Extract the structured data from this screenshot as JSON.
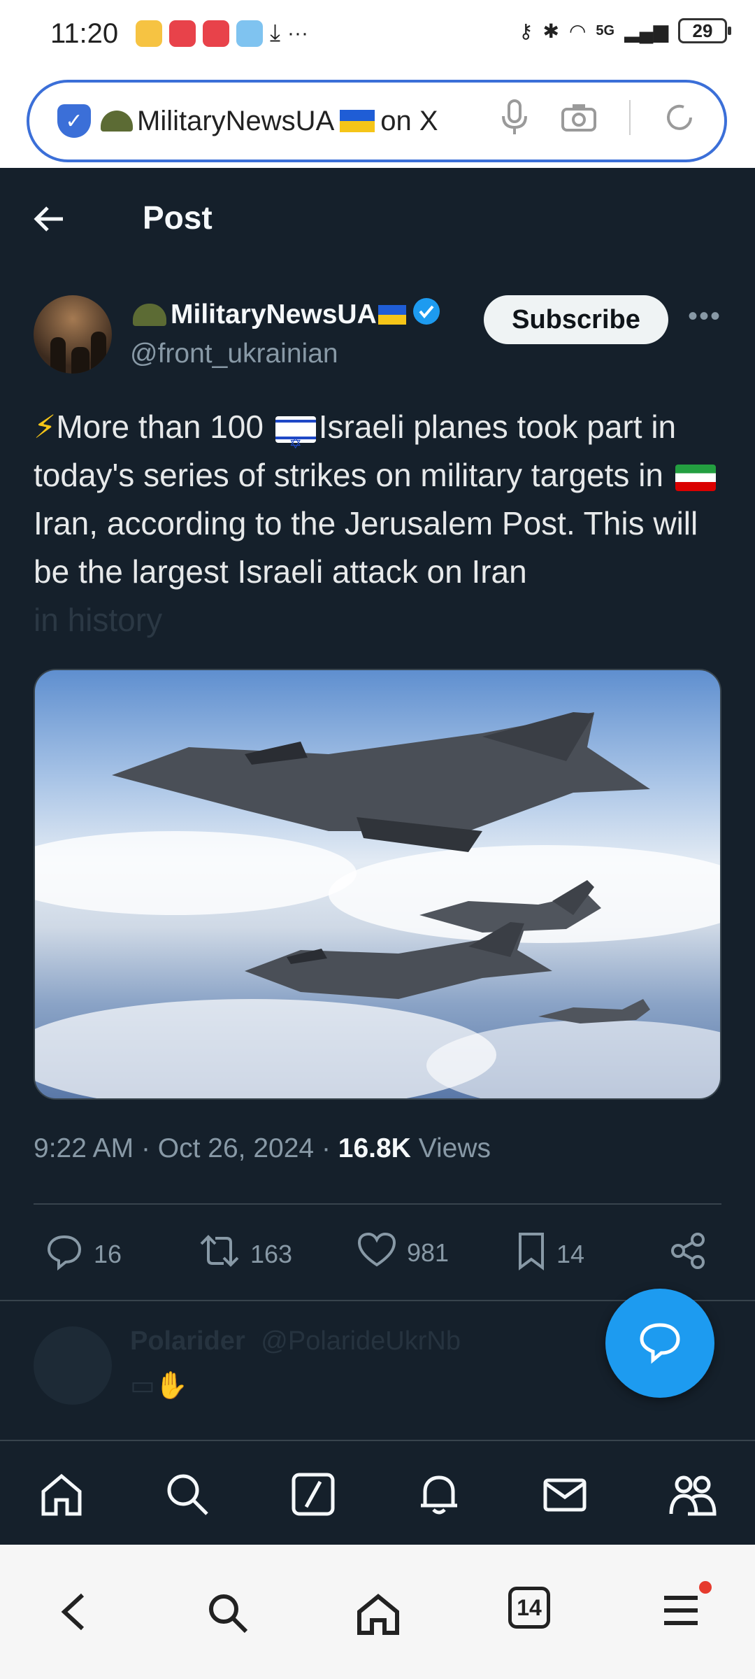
{
  "status_bar": {
    "time": "11:20",
    "battery": "29",
    "network": "5G"
  },
  "browser": {
    "url_title_prefix": "MilitaryNewsUA",
    "url_title_suffix": "on X",
    "tabs_count": "14"
  },
  "header": {
    "title": "Post"
  },
  "author": {
    "name": "MilitaryNewsUA",
    "handle": "@front_ukrainian",
    "subscribe_label": "Subscribe",
    "more_label": "•••"
  },
  "tweet": {
    "text_part1": "More than 100 ",
    "text_part2": "Israeli planes took part in today's series of strikes on military targets in ",
    "text_part3": "Iran, according to the Jerusalem Post. This will be the largest Israeli attack on Iran",
    "text_faded": "in history"
  },
  "meta": {
    "time": "9:22 AM",
    "date": "Oct 26, 2024",
    "views_count": "16.8K",
    "views_label": "Views"
  },
  "actions": {
    "replies": "16",
    "reposts": "163",
    "likes": "981",
    "bookmarks": "14"
  },
  "reply_preview": {
    "name": "Polarider",
    "handle": "@PolarideUkrNb"
  },
  "colors": {
    "background": "#15202b",
    "accent": "#1d9bf0",
    "text_primary": "#e7e9ea",
    "text_secondary": "#8899a6"
  }
}
